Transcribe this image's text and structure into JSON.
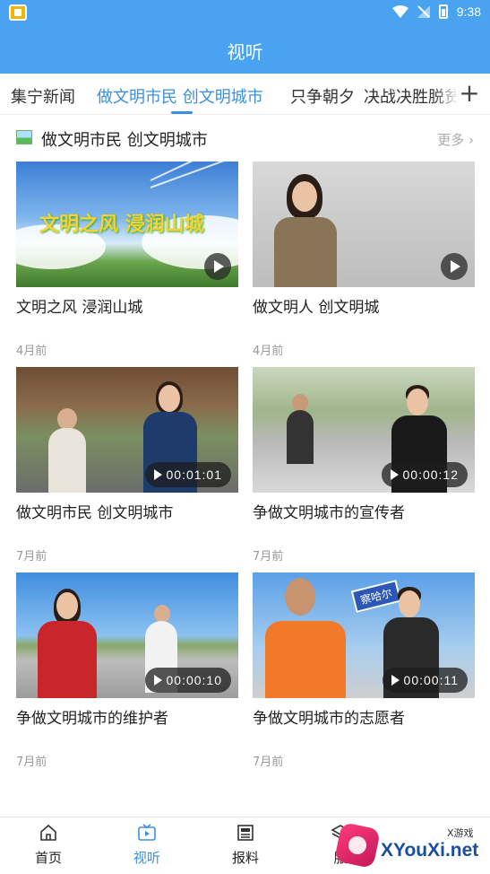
{
  "status_bar": {
    "time": "9:38"
  },
  "header": {
    "title": "视听"
  },
  "tabs": [
    {
      "label": "集宁新闻",
      "active": false
    },
    {
      "label": "做文明市民  创文明城市",
      "active": true
    },
    {
      "label": "只争朝夕",
      "active": false
    },
    {
      "label": "决战决胜脱贫",
      "active": false
    }
  ],
  "section": {
    "title": "做文明市民  创文明城市",
    "more_label": "更多"
  },
  "videos": [
    {
      "title": "文明之风  浸润山城",
      "date": "4月前",
      "duration": "",
      "banner_text": "文明之风 浸润山城"
    },
    {
      "title": "做文明人  创文明城",
      "date": "4月前",
      "duration": ""
    },
    {
      "title": "做文明市民  创文明城市",
      "date": "7月前",
      "duration": "00:01:01"
    },
    {
      "title": "争做文明城市的宣传者",
      "date": "7月前",
      "duration": "00:00:12"
    },
    {
      "title": "争做文明城市的维护者",
      "date": "7月前",
      "duration": "00:00:10"
    },
    {
      "title": "争做文明城市的志愿者",
      "date": "7月前",
      "duration": "00:00:11",
      "sign_text": "察哈尔"
    }
  ],
  "bottom_nav": [
    {
      "label": "首页",
      "icon": "home-icon",
      "active": false
    },
    {
      "label": "视听",
      "icon": "tv-icon",
      "active": true
    },
    {
      "label": "报料",
      "icon": "newspaper-icon",
      "active": false
    },
    {
      "label": "服",
      "icon": "layers-icon",
      "active": false
    }
  ],
  "watermark": {
    "text": "XYouXi.net",
    "small": "X游戏"
  },
  "colors": {
    "primary": "#4aa3f0",
    "accent": "#3b8fe0"
  }
}
